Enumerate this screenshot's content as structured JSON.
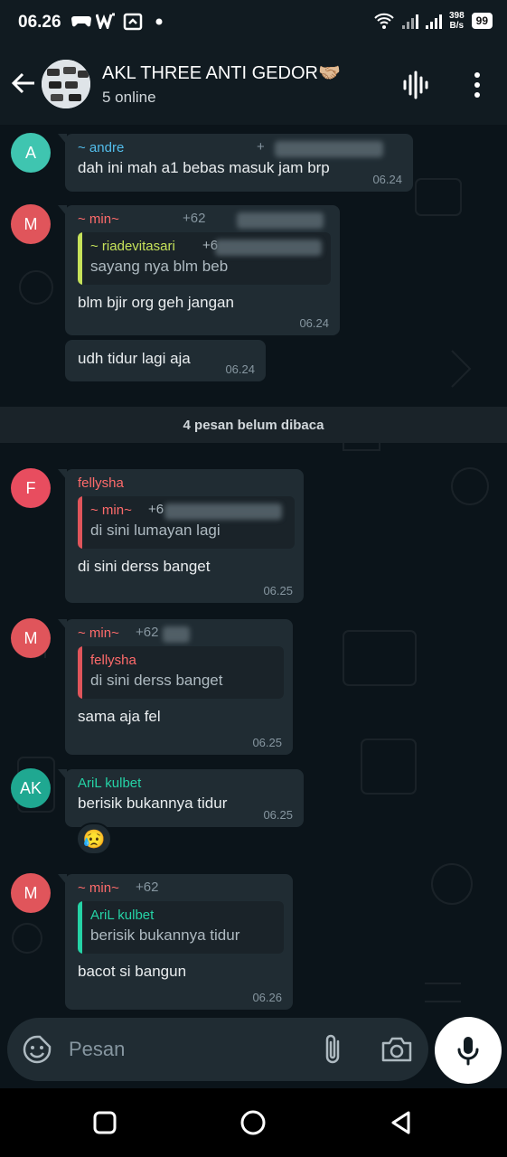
{
  "status_bar": {
    "time": "06.26",
    "speed_top": "398",
    "speed_bottom": "B/s",
    "battery": "99"
  },
  "header": {
    "title": "AKL THREE ANTI GEDOR🤝🏼",
    "subtitle": "5 online"
  },
  "messages": [
    {
      "avatar": "A",
      "sender": "~ andre",
      "phone": "+",
      "text": "dah ini mah a1 bebas masuk jam brp",
      "time": "06.24"
    },
    {
      "avatar": "M",
      "sender": "~ min~",
      "phone": "+62",
      "quote_name": "~ riadevitasari",
      "quote_phone": "+6",
      "quote_text": "sayang nya blm beb",
      "text": "blm bjir org geh jangan",
      "time": "06.24"
    },
    {
      "text": "udh tidur lagi aja",
      "time": "06.24"
    },
    {
      "avatar": "F",
      "sender": "fellysha",
      "quote_name": "~ min~",
      "quote_phone": "+6",
      "quote_text": "di sini lumayan lagi",
      "text": "di sini derss banget",
      "time": "06.25"
    },
    {
      "avatar": "M",
      "sender": "~ min~",
      "phone": "+62",
      "quote_name": "fellysha",
      "quote_text": "di sini derss banget",
      "text": "sama aja fel",
      "time": "06.25"
    },
    {
      "avatar": "AK",
      "sender": "AriL kulbet",
      "text": "berisik bukannya tidur",
      "time": "06.25",
      "reaction": "😥"
    },
    {
      "avatar": "M",
      "sender": "~ min~",
      "phone": "+62",
      "quote_name": "AriL kulbet",
      "quote_text": "berisik bukannya tidur",
      "text": "bacot si bangun",
      "time": "06.26"
    }
  ],
  "unread_banner": "4 pesan belum dibaca",
  "input": {
    "placeholder": "Pesan"
  },
  "colors": {
    "background": "#0b141a",
    "bubble": "#202c33",
    "andre": "#53bdeb",
    "min": "#ff6b6b",
    "fellysha": "#ff6b6b",
    "riadevitasari": "#c6e25a",
    "aril": "#25d3a6",
    "avatar_a": "#3fc5b0",
    "avatar_m": "#e0555b",
    "avatar_f": "#e84d5f",
    "avatar_ak": "#1fa891"
  }
}
